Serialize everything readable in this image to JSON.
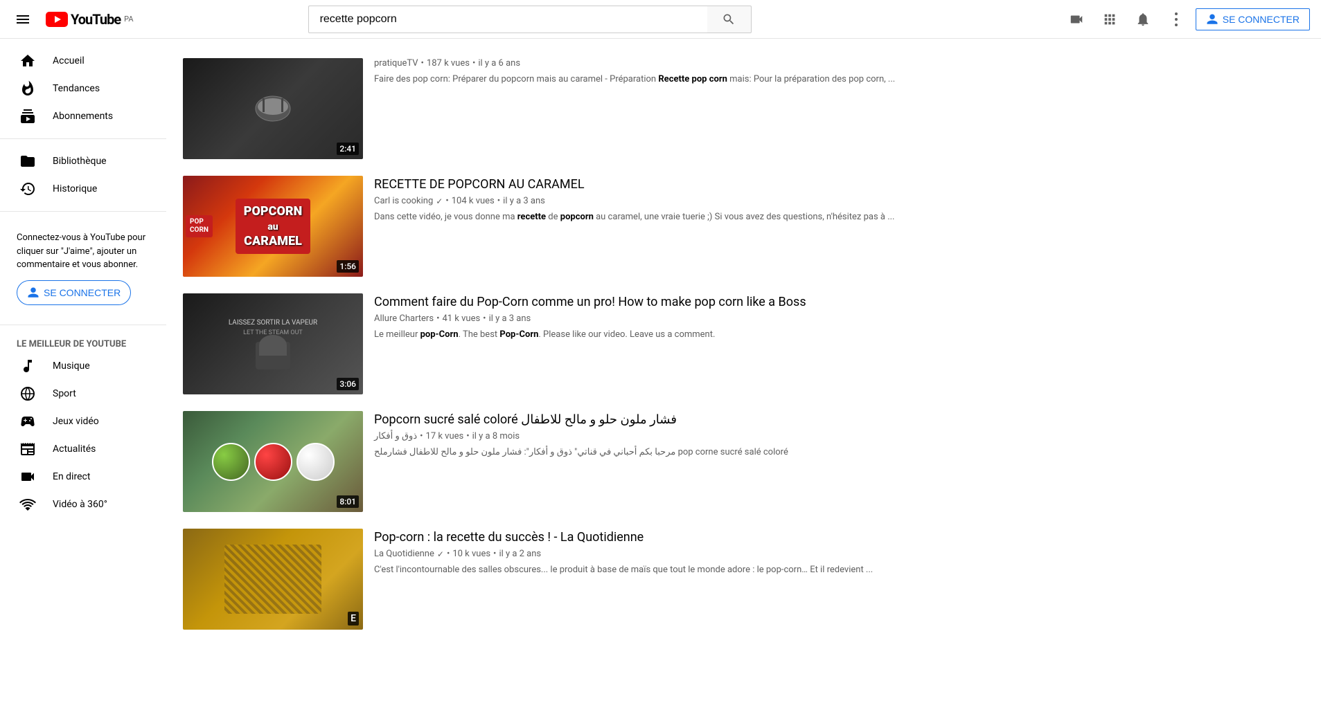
{
  "header": {
    "menu_label": "Menu",
    "logo_text": "YouTube",
    "logo_badge": "PA",
    "search_value": "recette popcorn",
    "search_placeholder": "Rechercher",
    "upload_label": "Importer une vidéo",
    "apps_label": "Applications YouTube",
    "notifications_label": "Notifications",
    "more_label": "Plus",
    "signin_label": "SE CONNECTER"
  },
  "sidebar": {
    "nav_items": [
      {
        "id": "accueil",
        "label": "Accueil",
        "icon": "home"
      },
      {
        "id": "tendances",
        "label": "Tendances",
        "icon": "flame"
      },
      {
        "id": "abonnements",
        "label": "Abonnements",
        "icon": "subscriptions"
      }
    ],
    "library_items": [
      {
        "id": "bibliotheque",
        "label": "Bibliothèque",
        "icon": "folder"
      },
      {
        "id": "historique",
        "label": "Historique",
        "icon": "history"
      }
    ],
    "signin_text": "Connectez-vous à YouTube pour cliquer sur \"J'aime\", ajouter un commentaire et vous abonner.",
    "signin_btn": "SE CONNECTER",
    "best_title": "LE MEILLEUR DE YOUTUBE",
    "best_items": [
      {
        "id": "musique",
        "label": "Musique",
        "icon": "music"
      },
      {
        "id": "sport",
        "label": "Sport",
        "icon": "sport"
      },
      {
        "id": "jeux-video",
        "label": "Jeux vidéo",
        "icon": "gamepad"
      },
      {
        "id": "actualites",
        "label": "Actualités",
        "icon": "news"
      },
      {
        "id": "en-direct",
        "label": "En direct",
        "icon": "live"
      },
      {
        "id": "video-360",
        "label": "Vidéo à 360°",
        "icon": "360"
      }
    ]
  },
  "videos": [
    {
      "id": "v1",
      "thumbnail_color": "#2a2a2a",
      "duration": "2:41",
      "title": "",
      "channel": "pratiqueTV",
      "verified": false,
      "views": "187 k vues",
      "age": "il y a 6 ans",
      "description": "Faire des pop corn: Préparer du popcorn mais au caramel - Préparation ",
      "desc_bold": "Recette pop corn",
      "desc_rest": " mais: Pour la préparation des pop corn, ..."
    },
    {
      "id": "v2",
      "thumbnail_color": "#8B1A1A",
      "duration": "1:56",
      "title": "RECETTE DE POPCORN AU CARAMEL",
      "channel": "Carl is cooking",
      "verified": true,
      "views": "104 k vues",
      "age": "il y a 3 ans",
      "description": "Dans cette vidéo, je vous donne ma ",
      "desc_bold": "recette",
      "desc_mid": " de ",
      "desc_bold2": "popcorn",
      "desc_rest": " au caramel, une vraie tuerie ;) Si vous avez des questions, n'hésitez pas à ..."
    },
    {
      "id": "v3",
      "thumbnail_color": "#1a1a1a",
      "duration": "3:06",
      "title": "Comment faire du Pop-Corn comme un pro! How to make pop corn like a Boss",
      "channel": "Allure Charters",
      "verified": false,
      "views": "41 k vues",
      "age": "il y a 3 ans",
      "description": "Le meilleur ",
      "desc_bold": "pop-Corn",
      "desc_mid": ". The best ",
      "desc_bold2": "Pop-Corn",
      "desc_rest": ". Please like our video. Leave us a comment."
    },
    {
      "id": "v4",
      "thumbnail_color": "#3a5a3a",
      "duration": "8:01",
      "title": "Popcorn sucré salé coloré فشار ملون حلو و مالح للاطفال",
      "channel": "ذوق و أفكار",
      "verified": false,
      "views": "17 k vues",
      "age": "il y a 8 mois",
      "description": "مرحبا بكم أحباني في قناتي\" ذوق و أفكار\": فشار ملون حلو و مالح للاطفال فشارملح pop corne sucré salé coloré"
    },
    {
      "id": "v5",
      "thumbnail_color": "#8B6914",
      "duration": "",
      "duration_letter": "E",
      "title": "Pop-corn : la recette du succès ! - La Quotidienne",
      "channel": "La Quotidienne",
      "verified": true,
      "views": "10 k vues",
      "age": "il y a 2 ans",
      "description": "C'est l'incontournable des salles obscures... le produit à base de maïs que tout le monde adore : le pop-corn… Et il redevient ..."
    }
  ]
}
